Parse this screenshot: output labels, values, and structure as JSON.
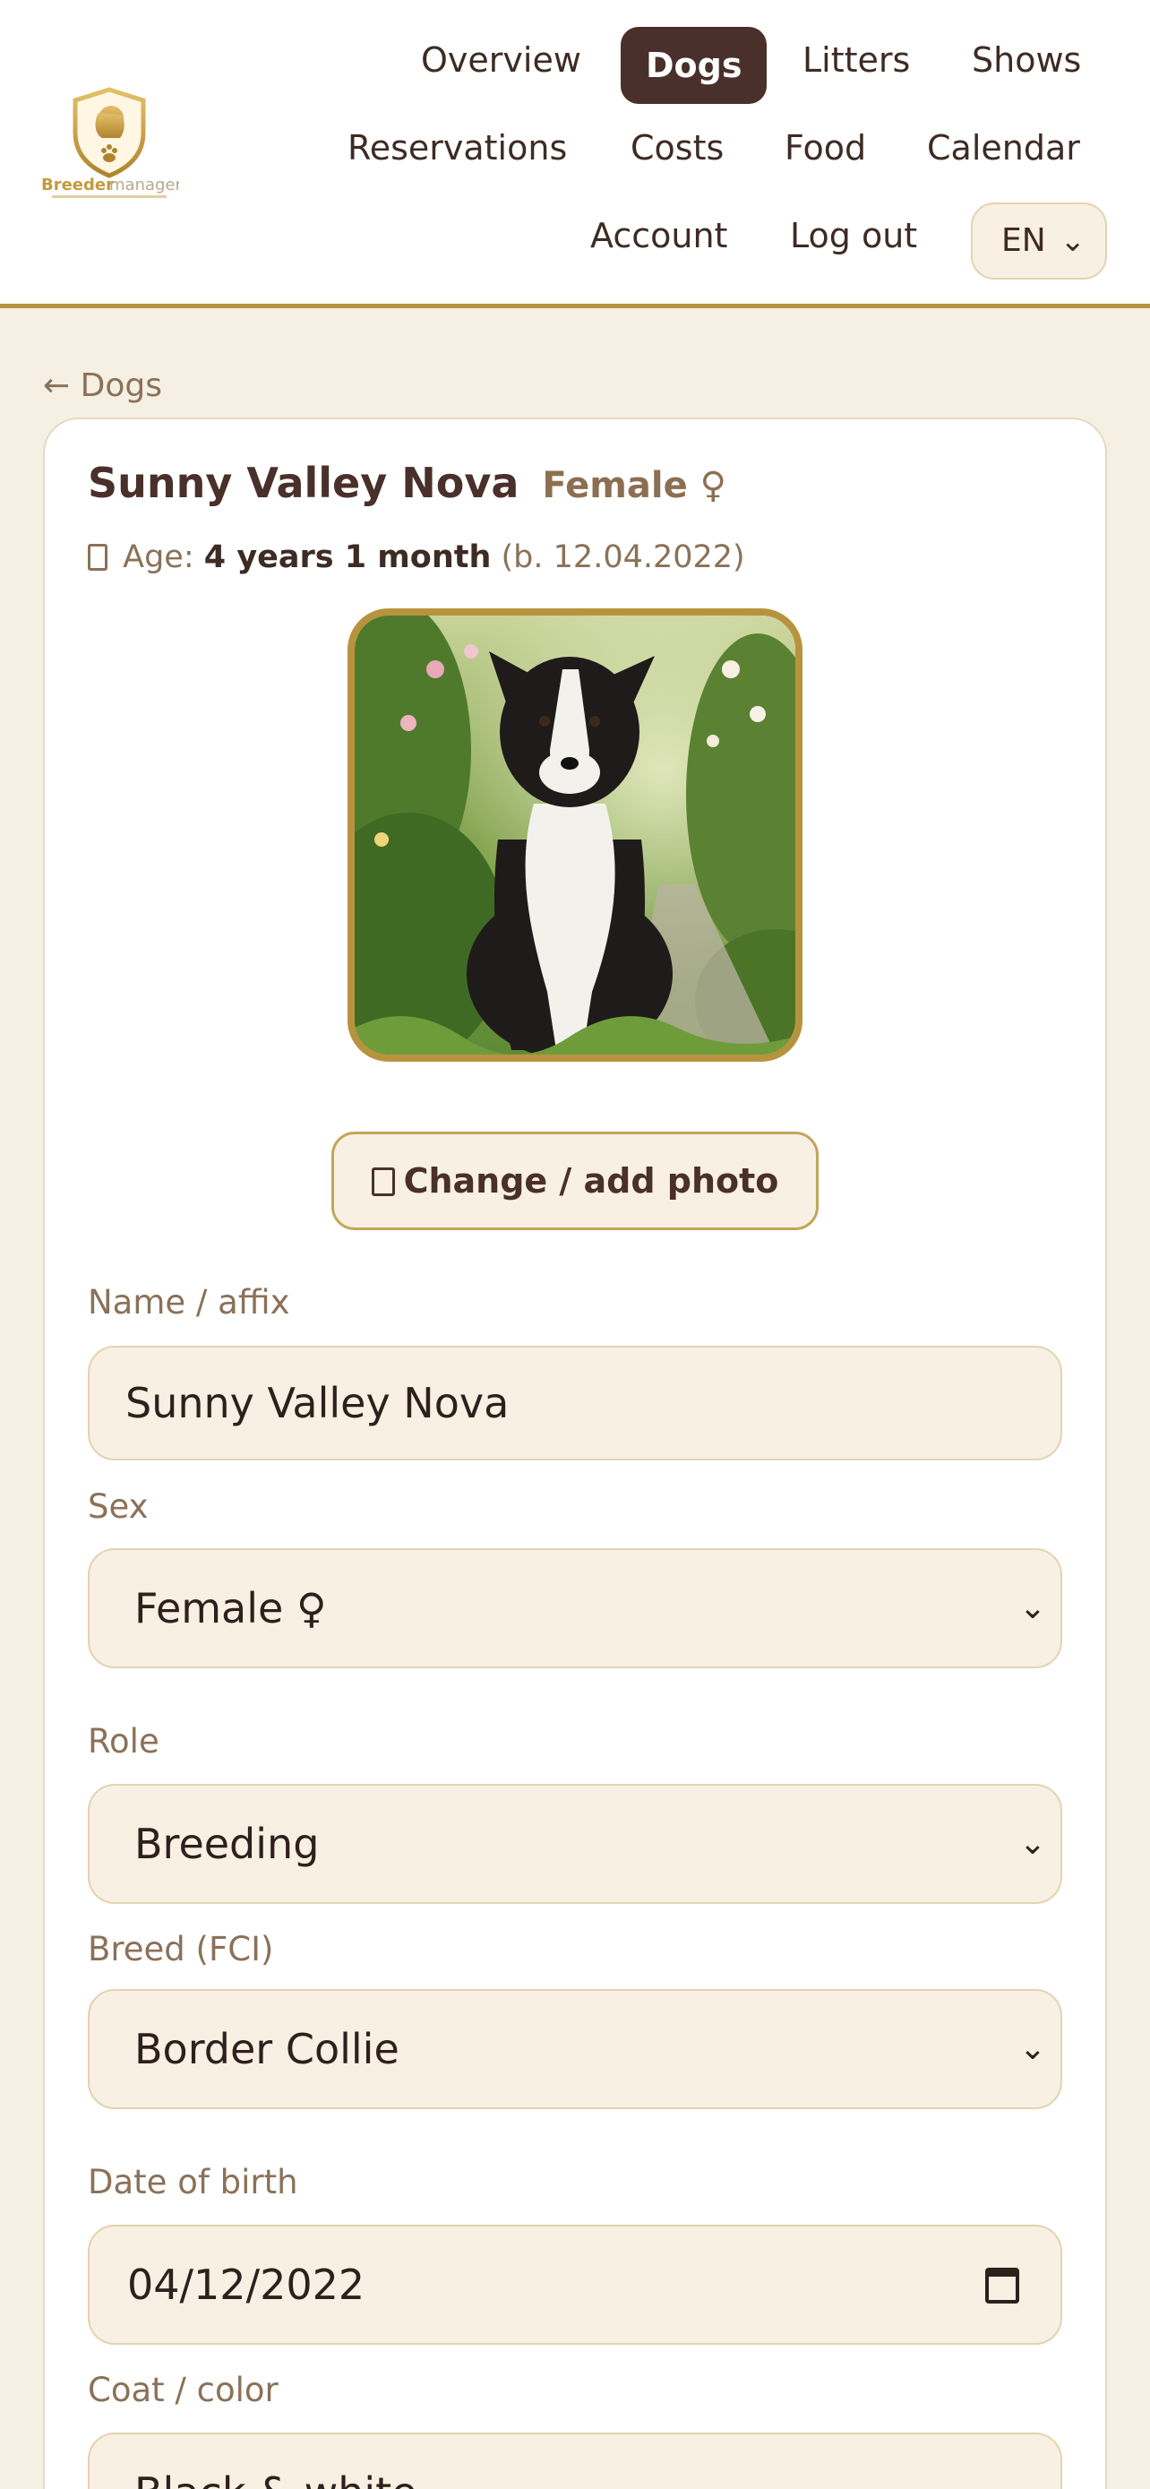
{
  "header": {
    "logo_alt": "Breeder manager",
    "nav": [
      {
        "label": "Overview"
      },
      {
        "label": "Dogs"
      },
      {
        "label": "Litters"
      },
      {
        "label": "Shows"
      },
      {
        "label": "Reservations"
      },
      {
        "label": "Costs"
      },
      {
        "label": "Food"
      },
      {
        "label": "Calendar"
      },
      {
        "label": "Account"
      },
      {
        "label": "Log out"
      }
    ],
    "active": "Dogs",
    "language": "EN"
  },
  "back_link": "← Dogs",
  "dog": {
    "name": "Sunny Valley Nova",
    "sex_label": "Female ♀",
    "age_prefix": "Age:",
    "age_icon": "calendar-icon",
    "age_value": "4 years 1 month",
    "birth_note": "(b. 12.04.2022)"
  },
  "photo_button": "Change / add photo",
  "photo_button_icon": "camera-icon",
  "form": {
    "name_label": "Name / affix",
    "name_value": "Sunny Valley Nova",
    "sex_label": "Sex",
    "sex_value": "Female ♀",
    "role_label": "Role",
    "role_value": "Breeding",
    "breed_label": "Breed (FCI)",
    "breed_value": "Border Collie",
    "dob_label": "Date of birth",
    "dob_value": "04/12/2022",
    "coat_label": "Coat / color",
    "coat_value": "Black & white"
  },
  "colors": {
    "accent": "#b8933e",
    "active_nav": "#4a302a",
    "background": "#f5efe4",
    "field_bg": "#f8f0e2"
  }
}
